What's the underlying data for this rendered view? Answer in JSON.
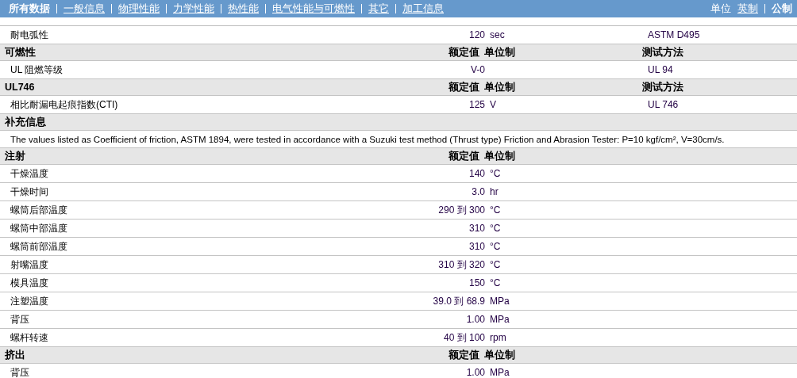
{
  "nav": {
    "tabs": [
      {
        "label": "所有数据",
        "selected": true
      },
      {
        "label": "一般信息",
        "selected": false
      },
      {
        "label": "物理性能",
        "selected": false
      },
      {
        "label": "力学性能",
        "selected": false
      },
      {
        "label": "热性能",
        "selected": false
      },
      {
        "label": "电气性能与可燃性",
        "selected": false
      },
      {
        "label": "其它",
        "selected": false
      },
      {
        "label": "加工信息",
        "selected": false
      }
    ],
    "units_label": "单位",
    "units": [
      {
        "label": "英制",
        "selected": false
      },
      {
        "label": "公制",
        "selected": true
      }
    ]
  },
  "sections": [
    {
      "kind": "table",
      "rows": [
        {
          "name": "耐电弧性",
          "value": "120",
          "unit": "sec",
          "method": "ASTM D495"
        }
      ]
    },
    {
      "kind": "table",
      "title": "可燃性",
      "columns": [
        "额定值",
        "单位制",
        "测试方法"
      ],
      "rows": [
        {
          "name": "UL 阻燃等级",
          "value": "V-0",
          "method": "UL 94"
        }
      ]
    },
    {
      "kind": "table",
      "title": "UL746",
      "columns": [
        "额定值",
        "单位制",
        "测试方法"
      ],
      "rows": [
        {
          "name": "相比耐漏电起痕指数(CTI)",
          "value": "125",
          "unit": "V",
          "method": "UL 746"
        }
      ]
    },
    {
      "kind": "note",
      "title": "补充信息",
      "text": "The values listed as Coefficient of friction, ASTM 1894, were tested in accordance with a Suzuki test method (Thrust type) Friction and Abrasion Tester: P=10 kgf/cm², V=30cm/s."
    },
    {
      "kind": "table",
      "title": "注射",
      "columns": [
        "额定值",
        "单位制"
      ],
      "rows": [
        {
          "name": "干燥温度",
          "value": "140",
          "unit": "°C"
        },
        {
          "name": "干燥时间",
          "value": "3.0",
          "unit": "hr"
        },
        {
          "name": "螺筒后部温度",
          "value": "290 到 300",
          "unit": "°C"
        },
        {
          "name": "螺筒中部温度",
          "value": "310",
          "unit": "°C"
        },
        {
          "name": "螺筒前部温度",
          "value": "310",
          "unit": "°C"
        },
        {
          "name": "射嘴温度",
          "value": "310 到 320",
          "unit": "°C"
        },
        {
          "name": "模具温度",
          "value": "150",
          "unit": "°C"
        },
        {
          "name": "注塑温度",
          "value": "39.0 到 68.9",
          "unit": "MPa"
        },
        {
          "name": "背压",
          "value": "1.00",
          "unit": "MPa"
        },
        {
          "name": "螺杆转速",
          "value": "40 到 100",
          "unit": "rpm"
        }
      ]
    },
    {
      "kind": "table",
      "title": "挤出",
      "columns": [
        "额定值",
        "单位制"
      ],
      "rows": [
        {
          "name": "背压",
          "value": "1.00",
          "unit": "MPa"
        }
      ]
    }
  ]
}
